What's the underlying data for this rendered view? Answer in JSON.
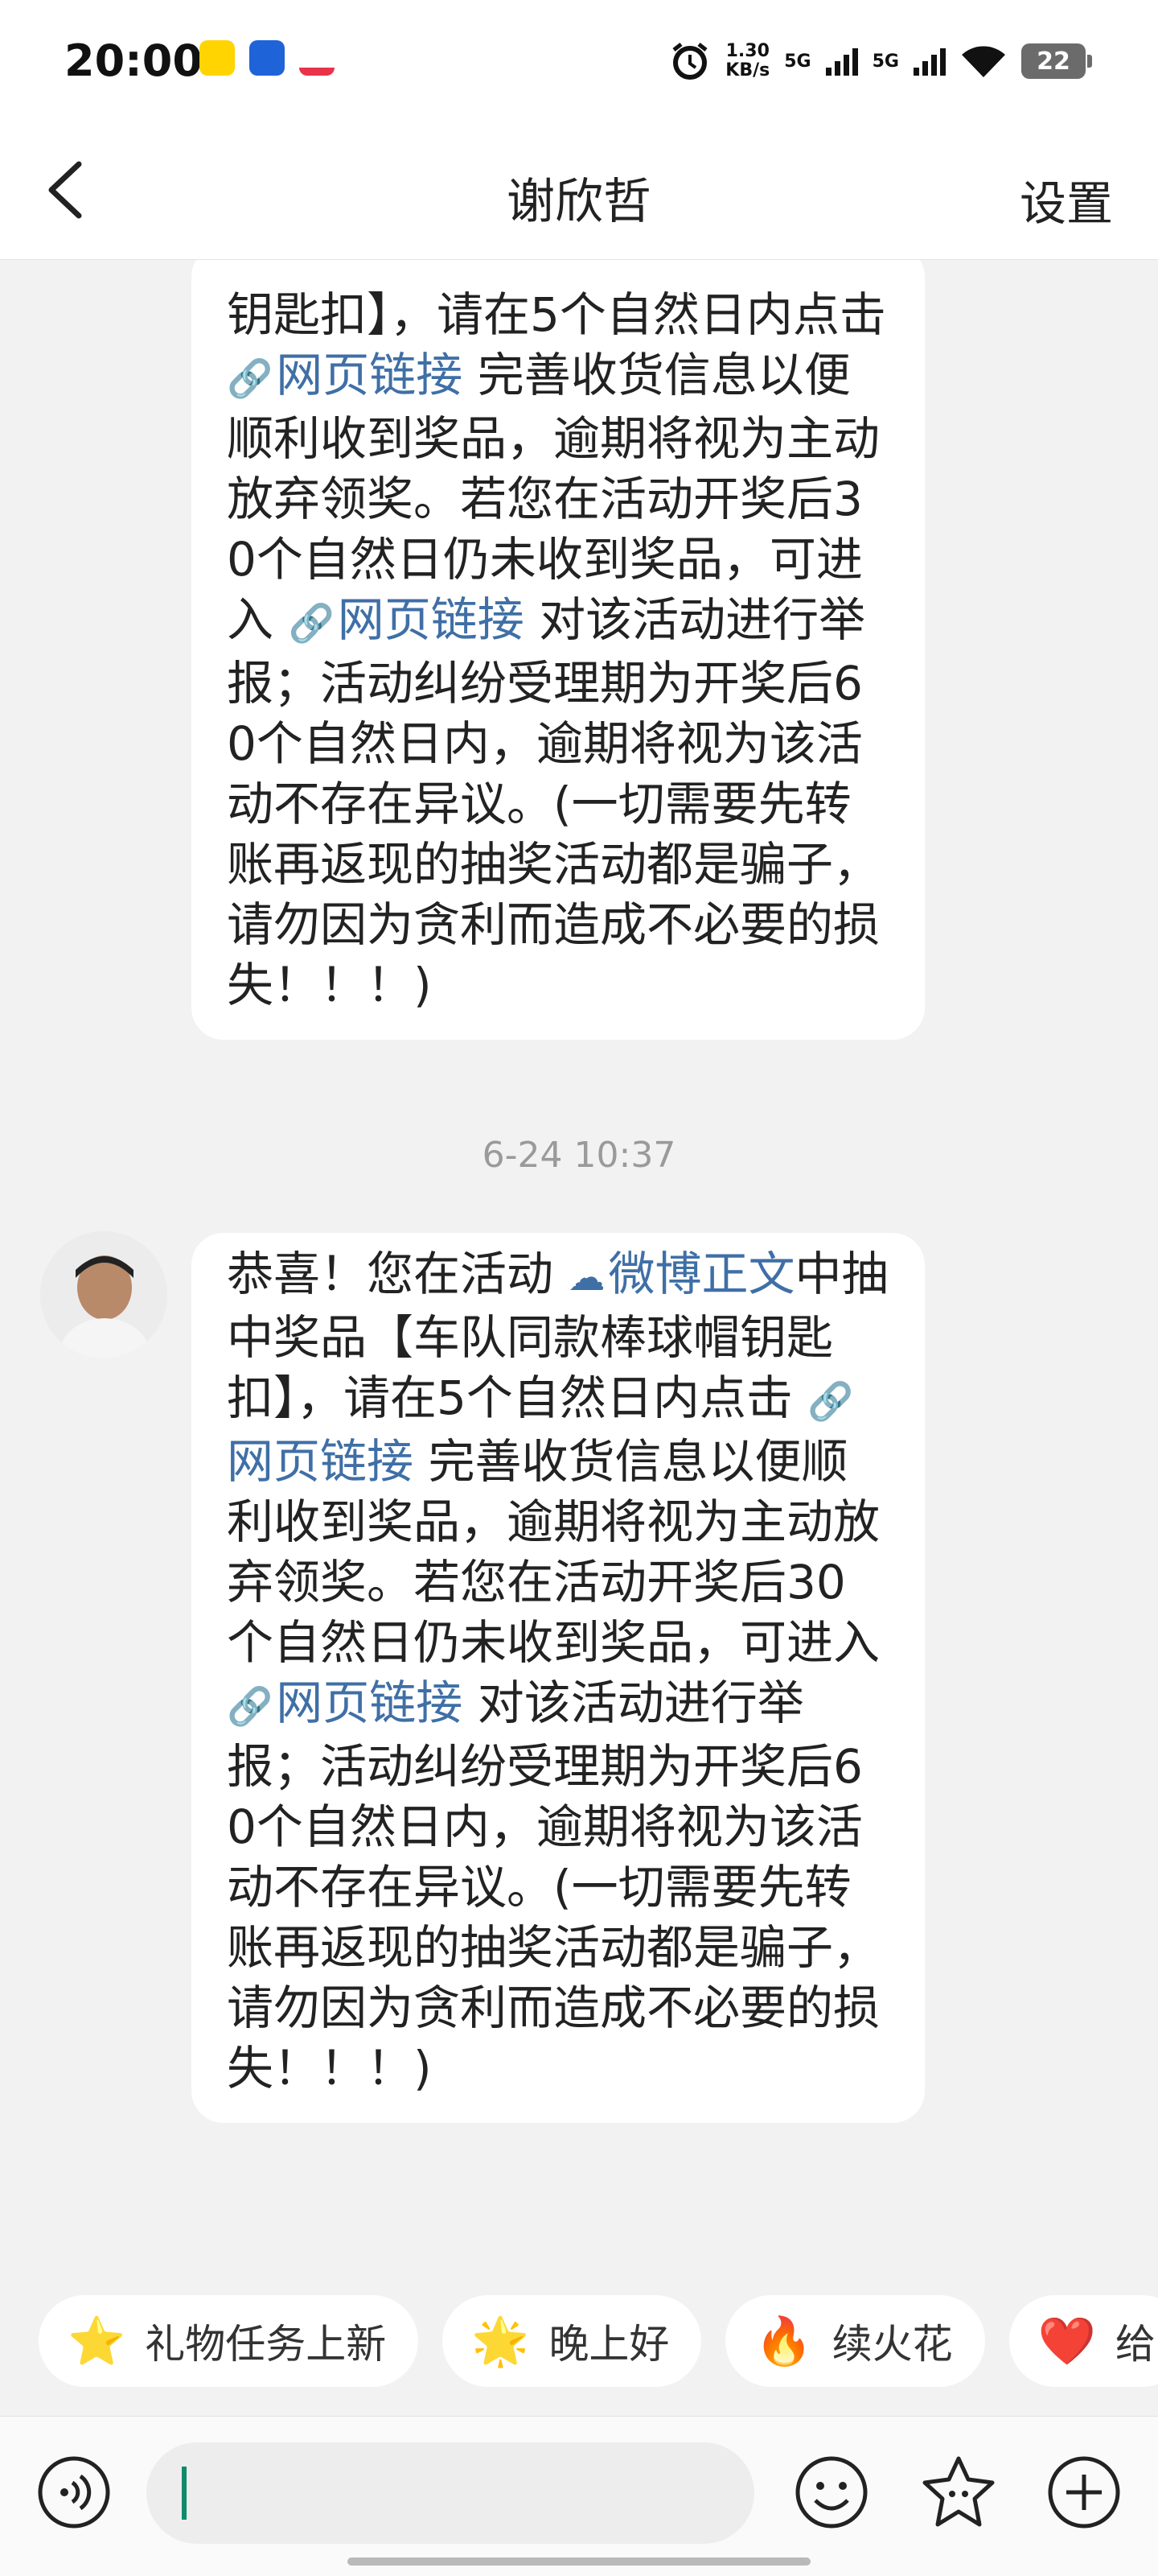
{
  "status_bar": {
    "time": "20:00",
    "speed_value": "1.30",
    "speed_unit": "KB/s",
    "net1": "5G",
    "net2": "5G",
    "battery": "22"
  },
  "nav": {
    "title": "谢欣哲",
    "settings": "设置"
  },
  "messages": [
    {
      "partial": true,
      "segments": [
        {
          "type": "text",
          "text": "钥匙扣】，请在5个自然日内点击 "
        },
        {
          "type": "link",
          "icon": "link-icon",
          "text": "网页链接"
        },
        {
          "type": "text",
          "text": " 完善收货信息以便顺利收到奖品，逾期将视为主动放弃领奖。若您在活动开奖后30个自然日仍未收到奖品，可进入 "
        },
        {
          "type": "link",
          "icon": "link-icon",
          "text": "网页链接"
        },
        {
          "type": "text",
          "text": " 对该活动进行举报；活动纠纷受理期为开奖后60个自然日内，逾期将视为该活动不存在异议。(一切需要先转账再返现的抽奖活动都是骗子，请勿因为贪利而造成不必要的损失！！！)"
        }
      ]
    },
    {
      "timestamp": "6-24 10:37",
      "segments": [
        {
          "type": "text",
          "text": "恭喜！您在活动 "
        },
        {
          "type": "link",
          "icon": "weibo-icon",
          "text": "微博正文"
        },
        {
          "type": "text",
          "text": "中抽中奖品【车队同款棒球帽钥匙扣】，请在5个自然日内点击 "
        },
        {
          "type": "link",
          "icon": "link-icon",
          "text": "网页链接"
        },
        {
          "type": "text",
          "text": " 完善收货信息以便顺利收到奖品，逾期将视为主动放弃领奖。若您在活动开奖后30个自然日仍未收到奖品，可进入 "
        },
        {
          "type": "link",
          "icon": "link-icon",
          "text": "网页链接"
        },
        {
          "type": "text",
          "text": " 对该活动进行举报；活动纠纷受理期为开奖后60个自然日内，逾期将视为该活动不存在异议。(一切需要先转账再返现的抽奖活动都是骗子，请勿因为贪利而造成不必要的损失！！！)"
        }
      ]
    }
  ],
  "quick_replies": [
    {
      "icon": "star-icon",
      "glyph": "⭐",
      "label": "礼物任务上新"
    },
    {
      "icon": "smiling-star-icon",
      "glyph": "🌟",
      "label": "晚上好"
    },
    {
      "icon": "fire-icon",
      "glyph": "🔥",
      "label": "续火花"
    },
    {
      "icon": "heart-icon",
      "glyph": "❤️",
      "label": "给"
    }
  ],
  "colors": {
    "link": "#3f6fa6",
    "caret": "#0f8a6a",
    "background": "#f2f2f2"
  }
}
